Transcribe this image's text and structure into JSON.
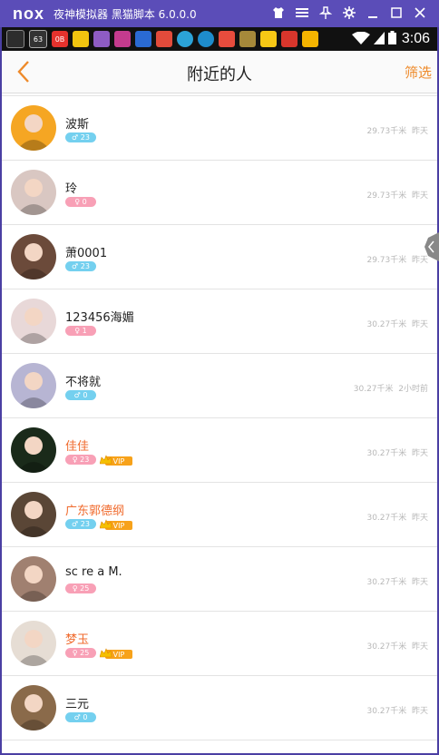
{
  "emulator": {
    "logo": "nox",
    "title": "夜神模拟器 黑猫脚本 6.0.0.0",
    "controls": [
      "shirt-icon",
      "menu-icon",
      "pin-icon",
      "gear-icon",
      "minimize-icon",
      "maximize-icon",
      "close-icon"
    ],
    "color": "#5b4db8"
  },
  "statusbar": {
    "time": "3:06",
    "notification_badges": [
      "63",
      "0B"
    ]
  },
  "header": {
    "title": "附近的人",
    "filter_label": "筛选",
    "accent": "#ee8a2a"
  },
  "people": [
    {
      "name": "波斯",
      "gender": "male",
      "age": "23",
      "vip": false,
      "distance": "29.73千米",
      "time": "昨天",
      "avatar_color": "#f5a623"
    },
    {
      "name": "玲",
      "gender": "female",
      "age": "0",
      "vip": false,
      "distance": "29.73千米",
      "time": "昨天",
      "avatar_color": "#d9c7c2"
    },
    {
      "name": "萧0001",
      "gender": "male",
      "age": "23",
      "vip": false,
      "distance": "29.73千米",
      "time": "昨天",
      "avatar_color": "#6b4a3a"
    },
    {
      "name": "123456海媚",
      "gender": "female",
      "age": "1",
      "vip": false,
      "distance": "30.27千米",
      "time": "昨天",
      "avatar_color": "#e8d8d8"
    },
    {
      "name": "不将就",
      "gender": "male",
      "age": "0",
      "vip": false,
      "distance": "30.27千米",
      "time": "2小时前",
      "avatar_color": "#b7b5d3"
    },
    {
      "name": "佳佳",
      "gender": "female",
      "age": "23",
      "vip": true,
      "distance": "30.27千米",
      "time": "昨天",
      "avatar_color": "#1a2a1a"
    },
    {
      "name": "广东郭德纲",
      "gender": "male",
      "age": "23",
      "vip": true,
      "distance": "30.27千米",
      "time": "昨天",
      "avatar_color": "#5a4636"
    },
    {
      "name": "sc re a M.",
      "gender": "female",
      "age": "25",
      "vip": false,
      "distance": "30.27千米",
      "time": "昨天",
      "avatar_color": "#a08070"
    },
    {
      "name": "梦玉",
      "gender": "female",
      "age": "25",
      "vip": true,
      "distance": "30.27千米",
      "time": "昨天",
      "avatar_color": "#e6ddd4"
    },
    {
      "name": "三元",
      "gender": "male",
      "age": "0",
      "vip": false,
      "distance": "30.27千米",
      "time": "昨天",
      "avatar_color": "#8a6a4a"
    }
  ],
  "vip_label": "VIP"
}
